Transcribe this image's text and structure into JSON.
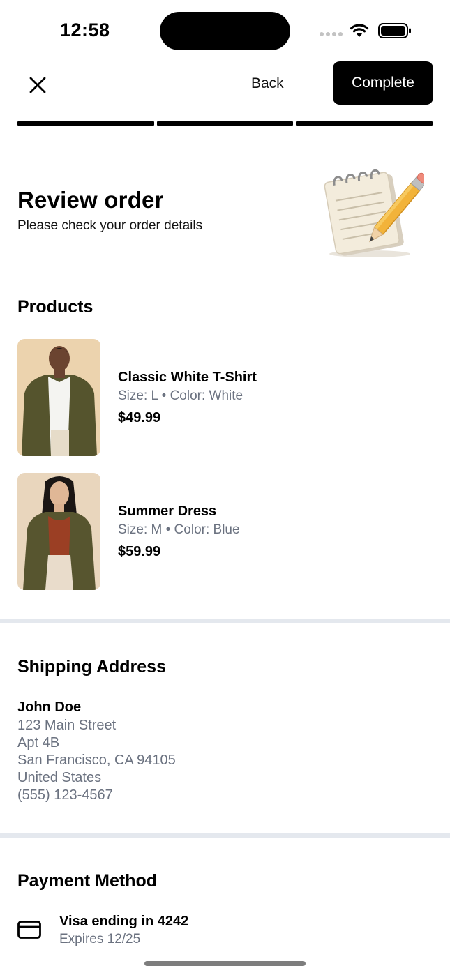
{
  "status_bar": {
    "time": "12:58"
  },
  "nav": {
    "back_label": "Back",
    "complete_label": "Complete",
    "close_icon": "close-icon"
  },
  "progress": {
    "steps_total": 3,
    "steps_completed": 3
  },
  "header": {
    "title": "Review order",
    "subtitle": "Please check your order details"
  },
  "products": {
    "heading": "Products",
    "items": [
      {
        "name": "Classic White T-Shirt",
        "meta": "Size: L • Color: White",
        "price": "$49.99"
      },
      {
        "name": "Summer Dress",
        "meta": "Size: M • Color: Blue",
        "price": "$59.99"
      }
    ]
  },
  "shipping": {
    "heading": "Shipping Address",
    "name": "John Doe",
    "lines": [
      "123 Main Street",
      "Apt 4B",
      "San Francisco, CA 94105",
      "United States",
      "(555) 123-4567"
    ]
  },
  "payment": {
    "heading": "Payment Method",
    "title": "Visa ending in 4242",
    "expires": "Expires 12/25",
    "icon": "credit-card-icon"
  },
  "colors": {
    "accent": "#000000",
    "muted_text": "#6b7280",
    "divider": "#e4e8ee"
  }
}
